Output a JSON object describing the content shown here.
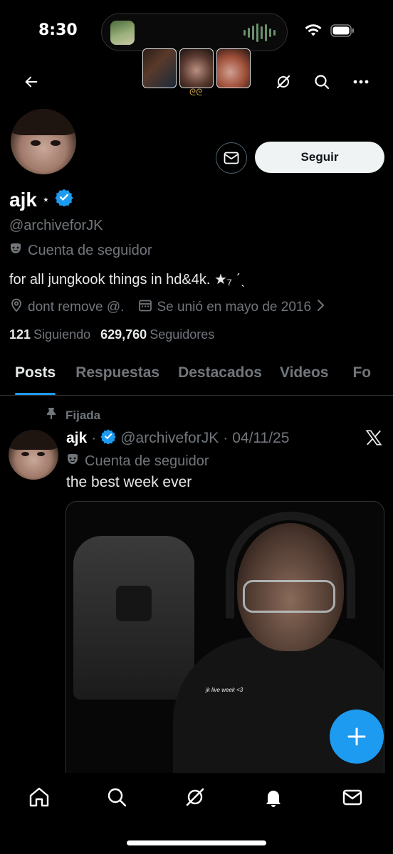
{
  "status_bar": {
    "time": "8:30"
  },
  "profile": {
    "display_name": "ajk",
    "name_sparkle": "⋆",
    "handle": "@archiveforJK",
    "account_label": "Cuenta de seguidor",
    "bio": "for all jungkook things in hd&4k. ★₇ ˊˎ",
    "location": "dont remove @.",
    "joined": "Se unió en mayo de 2016",
    "following_count": "121",
    "following_label": "Siguiendo",
    "followers_count": "629,760",
    "followers_label": "Seguidores",
    "follow_button": "Seguir"
  },
  "tabs": [
    {
      "label": "Posts"
    },
    {
      "label": "Respuestas"
    },
    {
      "label": "Destacados"
    },
    {
      "label": "Videos"
    },
    {
      "label": "Fo"
    }
  ],
  "pinned_tweet": {
    "pinned_label": "Fijada",
    "name": "ajk",
    "handle": "@archiveforJK",
    "separator": "·",
    "date": "04/11/25",
    "account_label": "Cuenta de seguidor",
    "text": "the best week ever",
    "media_caption": "jk live week <3"
  },
  "colors": {
    "accent": "#1d9bf0",
    "background": "#000000",
    "muted": "#71767b"
  }
}
